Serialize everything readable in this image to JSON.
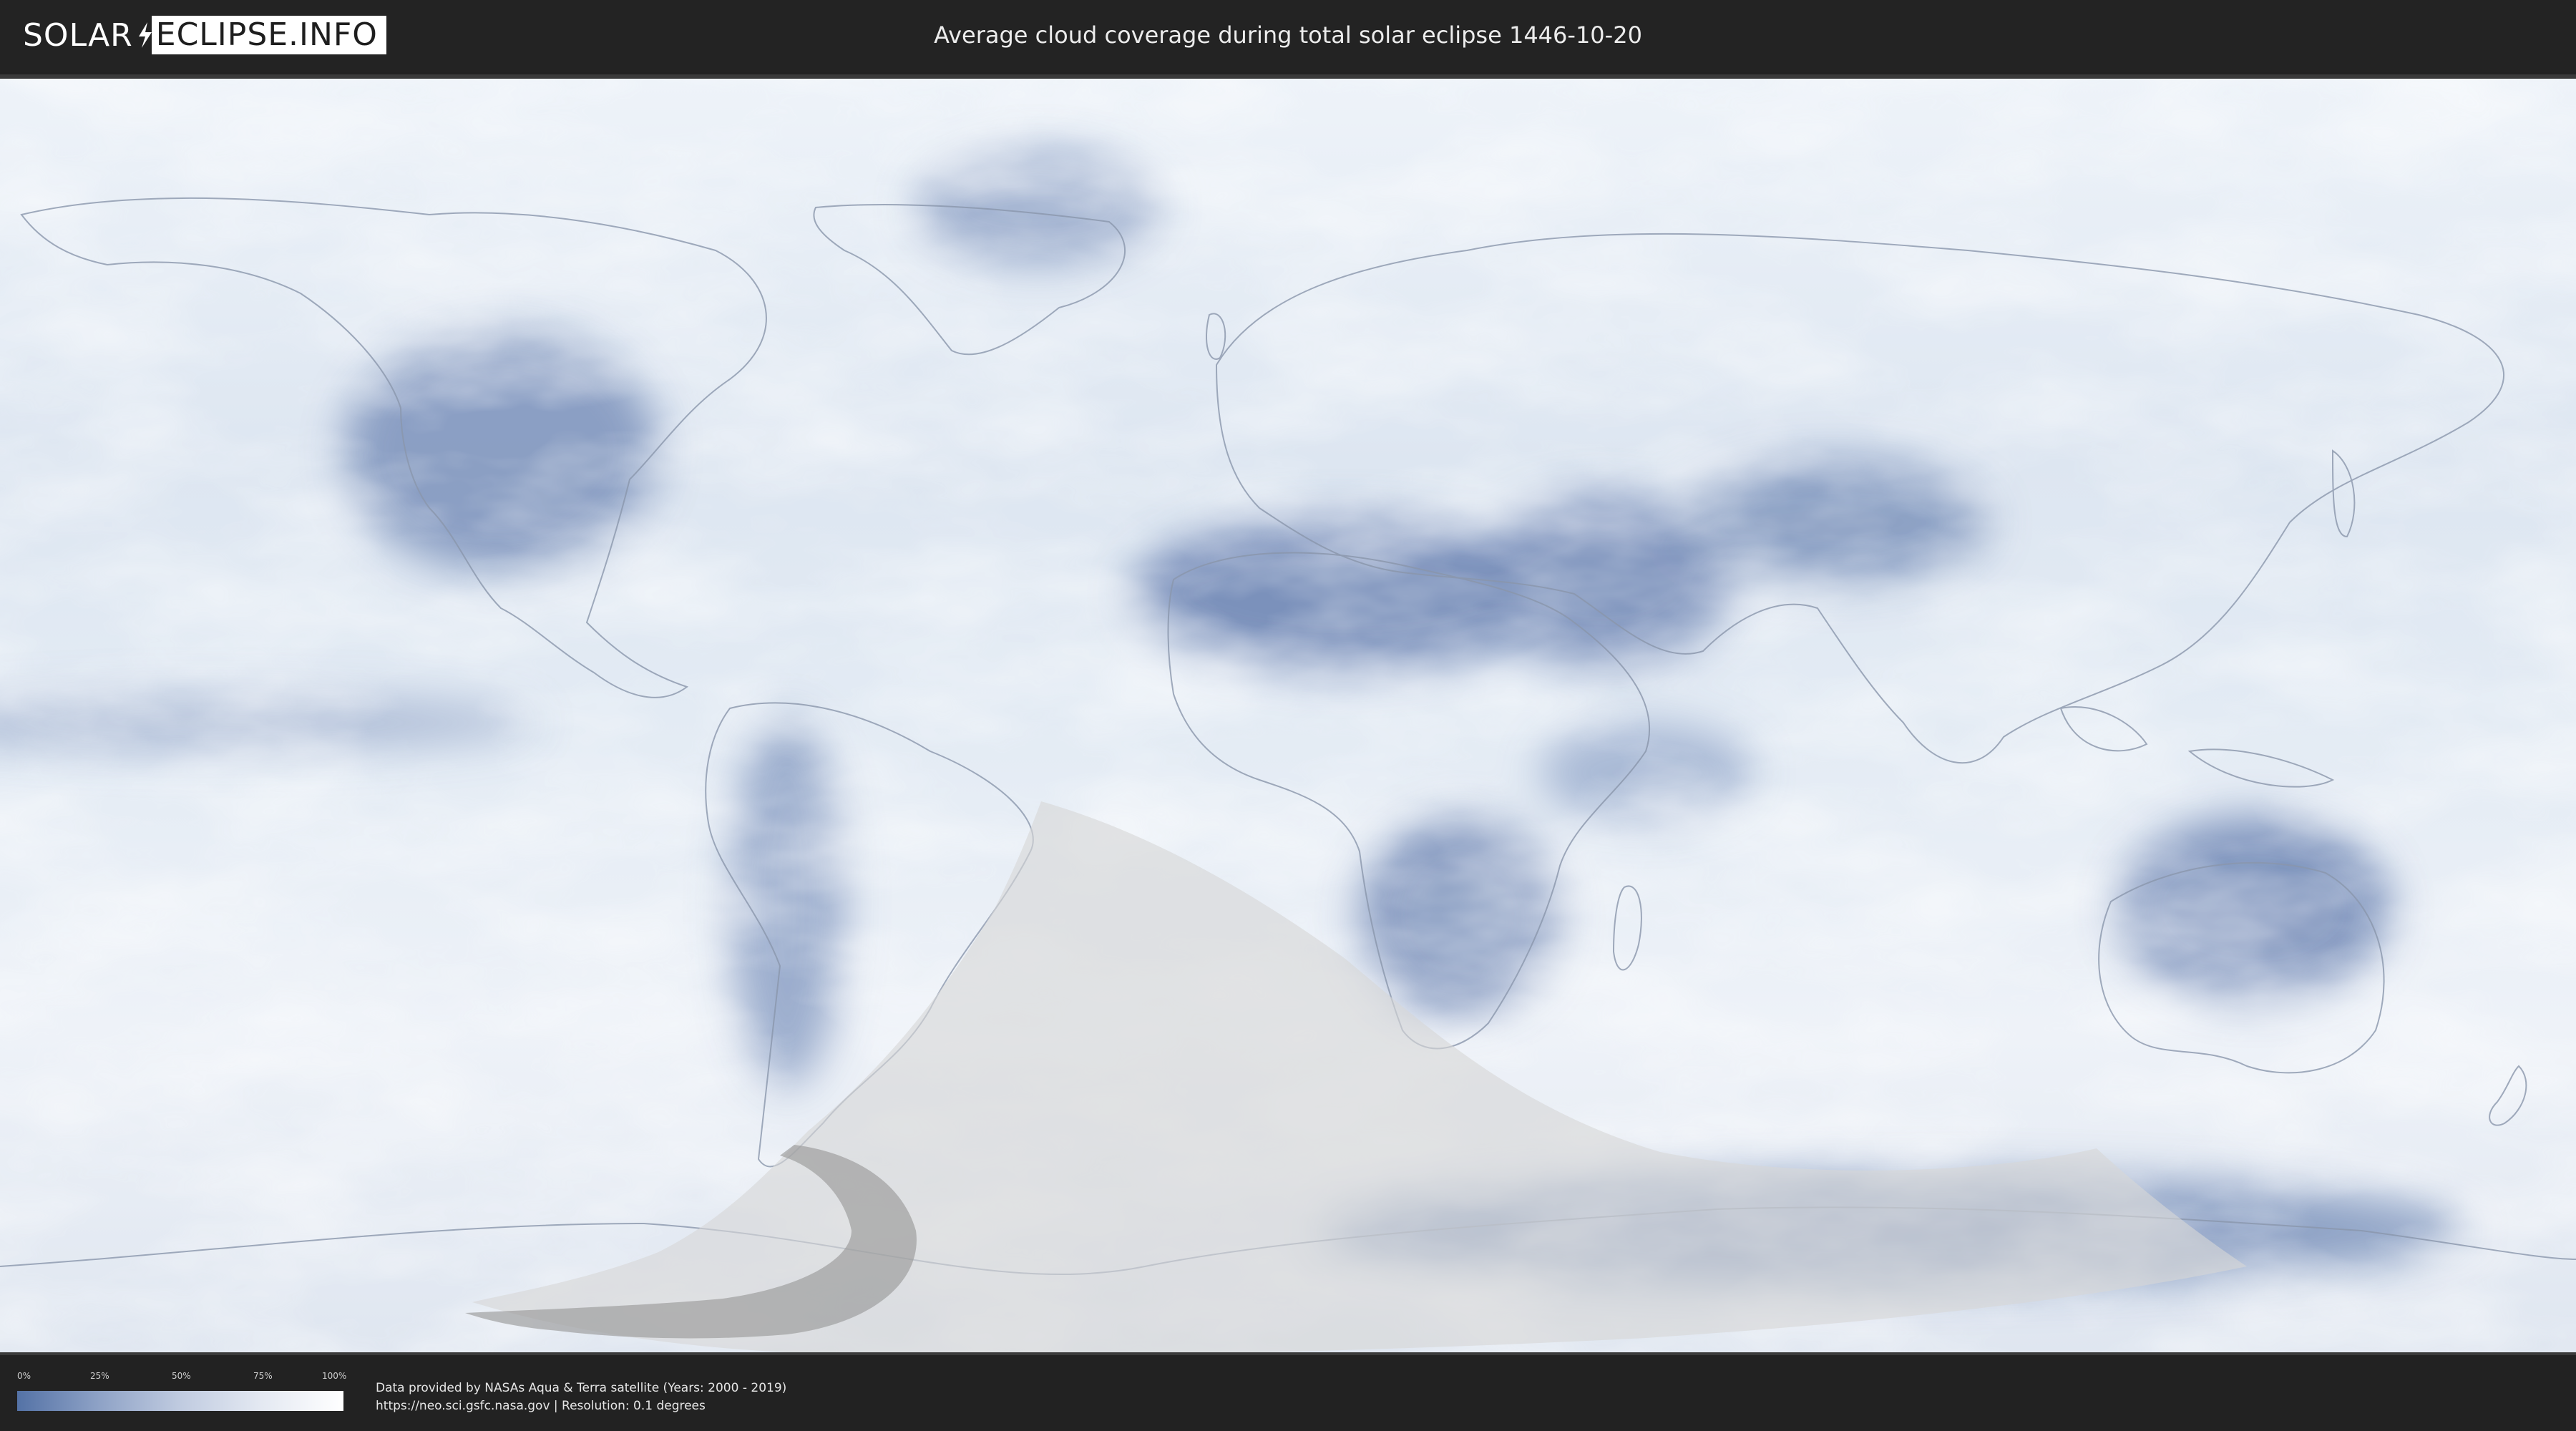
{
  "header": {
    "logo_left": "SOLAR",
    "logo_right": "ECLIPSE.INFO",
    "title": "Average cloud coverage during total solar eclipse 1446-10-20"
  },
  "map": {
    "ocean_color": "#e9eef6",
    "clear_sky_color": "#5472a6",
    "full_cloud_color": "#ffffff",
    "eclipse_overlay_color": "#d6d6d6",
    "totality_path_color": "#9a9a9a",
    "icons": [
      "world-map",
      "eclipse-visibility-region",
      "totality-path"
    ]
  },
  "legend": {
    "ticks": [
      "0%",
      "25%",
      "50%",
      "75%",
      "100%"
    ]
  },
  "credits": {
    "line1": "Data provided by NASAs Aqua & Terra satellite (Years: 2000 - 2019)",
    "line2": "https://neo.sci.gsfc.nasa.gov | Resolution: 0.1 degrees"
  }
}
